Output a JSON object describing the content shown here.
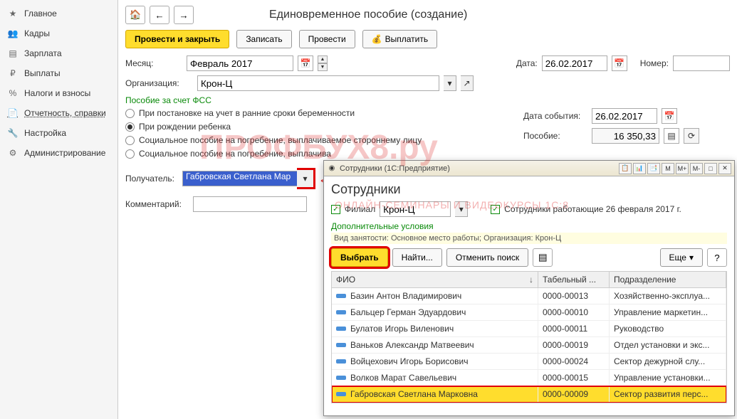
{
  "sidebar": {
    "items": [
      {
        "label": "Главное",
        "icon": "★"
      },
      {
        "label": "Кадры",
        "icon": "👥"
      },
      {
        "label": "Зарплата",
        "icon": "▤"
      },
      {
        "label": "Выплаты",
        "icon": "₽"
      },
      {
        "label": "Налоги и взносы",
        "icon": "%"
      },
      {
        "label": "Отчетность, справки",
        "icon": "📄",
        "active": true
      },
      {
        "label": "Настройка",
        "icon": "🔧"
      },
      {
        "label": "Администрирование",
        "icon": "⚙"
      }
    ]
  },
  "page": {
    "title": "Единовременное пособие (создание)"
  },
  "actions": {
    "post_close": "Провести и закрыть",
    "write": "Записать",
    "post": "Провести",
    "pay": "Выплатить"
  },
  "form": {
    "month_label": "Месяц:",
    "month_value": "Февраль 2017",
    "date_label": "Дата:",
    "date_value": "26.02.2017",
    "number_label": "Номер:",
    "number_value": "",
    "org_label": "Организация:",
    "org_value": "Крон-Ц",
    "fss_header": "Пособие за счет ФСС",
    "radio1": "При постановке на учет в ранние сроки беременности",
    "radio2": "При рождении ребенка",
    "radio3": "Социальное пособие на погребение, выплачиваемое стороннему лицу",
    "radio4": "Социальное пособие на погребение, выплачива",
    "event_date_label": "Дата события:",
    "event_date_value": "26.02.2017",
    "benefit_label": "Пособие:",
    "benefit_value": "16 350,33",
    "recipient_label": "Получатель:",
    "recipient_value": "Габровская Светлана Мар",
    "comment_label": "Комментарий:"
  },
  "popup": {
    "title": "Сотрудники (1С:Предприятие)",
    "heading": "Сотрудники",
    "branch_label": "Филиал",
    "branch_value": "Крон-Ц",
    "working_label": "Сотрудники работающие 26 февраля 2017 г.",
    "extra_cond": "Дополнительные условия",
    "filter_text": "Вид занятости: Основное место работы; Организация: Крон-Ц",
    "btn_select": "Выбрать",
    "btn_find": "Найти...",
    "btn_cancel": "Отменить поиск",
    "btn_more": "Еще",
    "col_fio": "ФИО",
    "col_tab": "Табельный ...",
    "col_dep": "Подразделение",
    "rows": [
      {
        "fio": "Базин Антон Владимирович",
        "tab": "0000-00013",
        "dep": "Хозяйственно-эксплуа..."
      },
      {
        "fio": "Бальцер Герман Эдуардович",
        "tab": "0000-00010",
        "dep": "Управление маркетин..."
      },
      {
        "fio": "Булатов Игорь Виленович",
        "tab": "0000-00011",
        "dep": "Руководство"
      },
      {
        "fio": "Ваньков Александр Матвеевич",
        "tab": "0000-00019",
        "dep": "Отдел установки и экс..."
      },
      {
        "fio": "Войцехович Игорь Борисович",
        "tab": "0000-00024",
        "dep": "Сектор дежурной слу..."
      },
      {
        "fio": "Волков Марат Савельевич",
        "tab": "0000-00015",
        "dep": "Управление установки..."
      },
      {
        "fio": "Габровская Светлана Марковна",
        "tab": "0000-00009",
        "dep": "Сектор развития перс...",
        "selected": true
      }
    ],
    "titlebar_btns": [
      "📋",
      "📊",
      "📑",
      "M",
      "M+",
      "M-",
      "□",
      "✕"
    ]
  },
  "watermark": "ПРОФБУХ8.ру",
  "watermark_sub": "ОНЛАЙН-СЕМИНАРЫ И ВИДЕОКУРСЫ 1С:8"
}
